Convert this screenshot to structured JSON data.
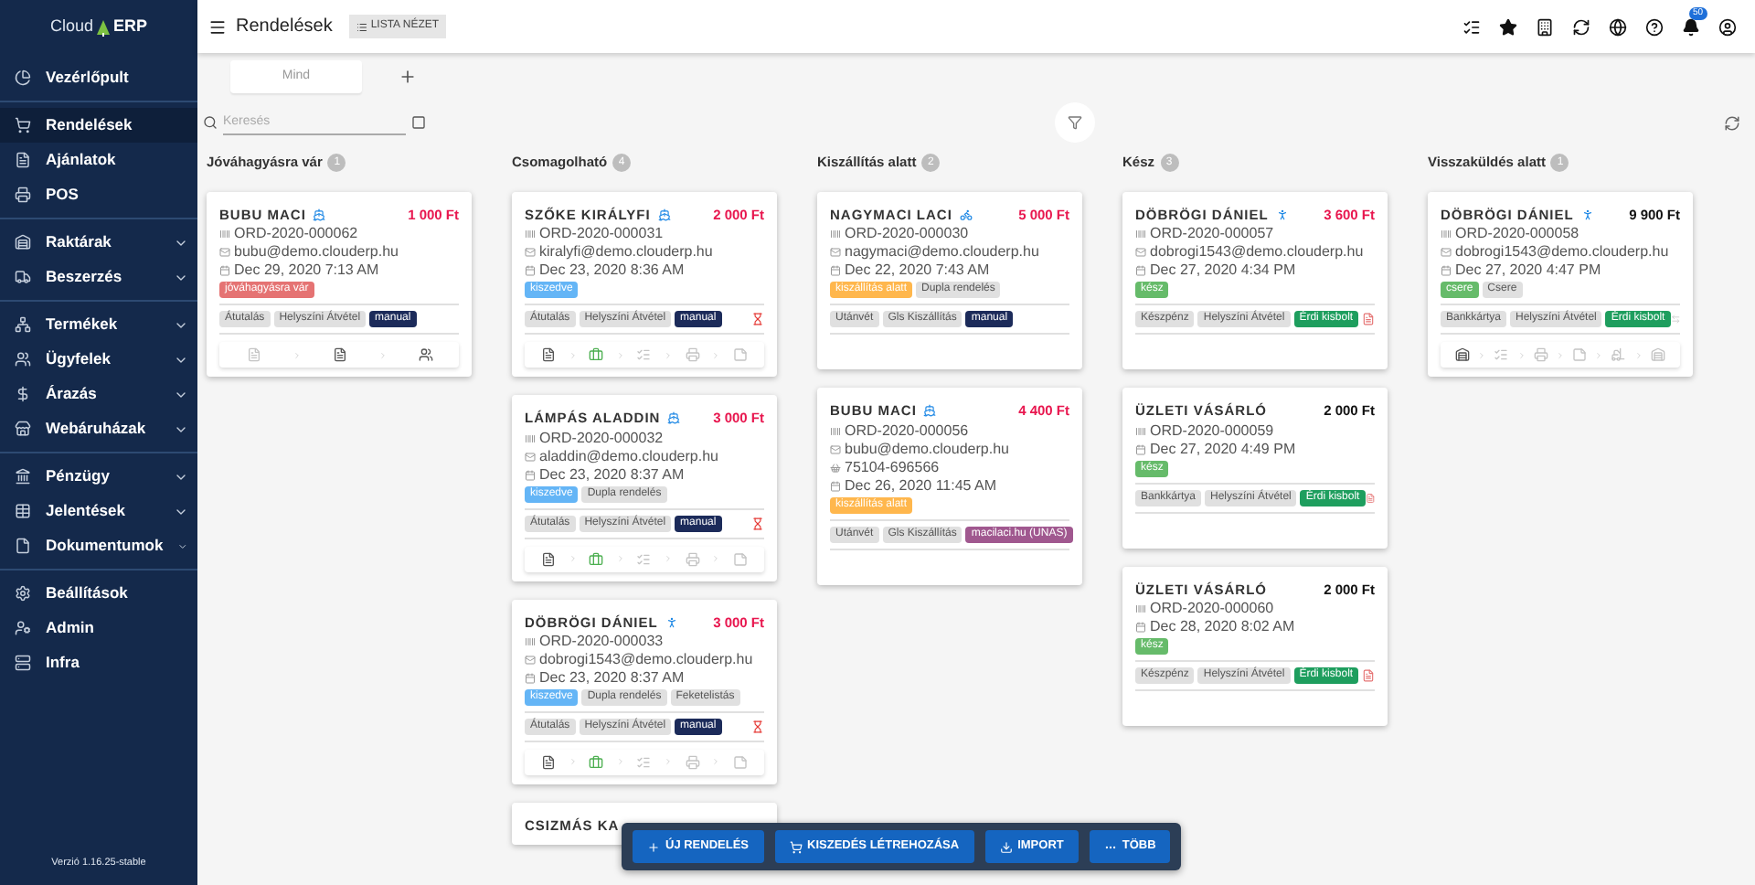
{
  "sidebar": {
    "logo": {
      "left": "Cloud",
      "right": "ERP"
    },
    "groups": [
      [
        {
          "label": "Vezérlőpult",
          "kind": "dashboard",
          "expandable": false,
          "selected": false
        }
      ],
      [
        {
          "label": "Rendelések",
          "kind": "cart",
          "expandable": false,
          "selected": true
        },
        {
          "label": "Ajánlatok",
          "kind": "offer",
          "expandable": false,
          "selected": false
        },
        {
          "label": "POS",
          "kind": "pos",
          "expandable": false,
          "selected": false
        }
      ],
      [
        {
          "label": "Raktárak",
          "kind": "warehouse",
          "expandable": true,
          "selected": false
        },
        {
          "label": "Beszerzés",
          "kind": "truck",
          "expandable": true,
          "selected": false
        }
      ],
      [
        {
          "label": "Termékek",
          "kind": "products",
          "expandable": true,
          "selected": false
        },
        {
          "label": "Ügyfelek",
          "kind": "customers",
          "expandable": true,
          "selected": false
        },
        {
          "label": "Árazás",
          "kind": "pricing",
          "expandable": true,
          "selected": false
        },
        {
          "label": "Webáruházak",
          "kind": "store",
          "expandable": true,
          "selected": false
        }
      ],
      [
        {
          "label": "Pénzügy",
          "kind": "finance",
          "expandable": true,
          "selected": false
        },
        {
          "label": "Jelentések",
          "kind": "reports",
          "expandable": true,
          "selected": false
        },
        {
          "label": "Dokumentumok",
          "kind": "documents",
          "expandable": true,
          "selected": false
        }
      ],
      [
        {
          "label": "Beállítások",
          "kind": "settings",
          "expandable": false,
          "selected": false
        },
        {
          "label": "Admin",
          "kind": "admin",
          "expandable": false,
          "selected": false
        },
        {
          "label": "Infra",
          "kind": "infra",
          "expandable": false,
          "selected": false
        }
      ]
    ],
    "version": "Verzió 1.16.25-stable"
  },
  "topbar": {
    "title": "Rendelések",
    "view_button": "LISTA NÉZET",
    "notification_count": "50"
  },
  "tabs": [
    {
      "label": "Mind",
      "selected": true
    }
  ],
  "search": {
    "placeholder": "Keresés"
  },
  "columns": [
    {
      "title": "Jóváhagyásra vár",
      "count": "1",
      "cards": [
        {
          "name": "BUBU MACI",
          "customer_icon": {
            "kind": "ship"
          },
          "amount": "1 000 Ft",
          "amount_highlight": true,
          "order": "ORD-2020-000062",
          "email": "bubu@demo.clouderp.hu",
          "date": "Dec 29, 2020 7:13 AM",
          "status_tags": [
            {
              "label": "jóváhagyásra vár",
              "color": "#e57373"
            }
          ],
          "info_tags": [
            {
              "label": "Átutalás",
              "color": "#e0e0e0"
            },
            {
              "label": "Helyszíni Átvétel",
              "color": "#e0e0e0"
            },
            {
              "label": "manual",
              "color": "#1c2b5a"
            }
          ],
          "steps": [
            {
              "kind": "document",
              "done": false,
              "active": false
            },
            {
              "kind": "document",
              "done": true,
              "active": false
            },
            {
              "kind": "people",
              "done": true,
              "active": false
            }
          ]
        }
      ]
    },
    {
      "title": "Csomagolható",
      "count": "4",
      "cards": [
        {
          "name": "SZŐKE KIRÁLYFI",
          "customer_icon": {
            "kind": "ship"
          },
          "amount": "2 000 Ft",
          "amount_highlight": true,
          "order": "ORD-2020-000031",
          "email": "kiralyfi@demo.clouderp.hu",
          "date": "Dec 23, 2020 8:36 AM",
          "status_tags": [
            {
              "label": "kiszedve",
              "color": "#64b5f6"
            }
          ],
          "info_tags": [
            {
              "label": "Átutalás",
              "color": "#e0e0e0"
            },
            {
              "label": "Helyszíni Átvétel",
              "color": "#e0e0e0"
            },
            {
              "label": "manual",
              "color": "#1c2b5a"
            }
          ],
          "flag": {
            "kind": "hourglass"
          },
          "steps": [
            {
              "kind": "document",
              "done": true,
              "active": false
            },
            {
              "kind": "briefcase",
              "done": false,
              "active": true
            },
            {
              "kind": "list",
              "done": false,
              "active": false
            },
            {
              "kind": "printer",
              "done": false,
              "active": false
            },
            {
              "kind": "note",
              "done": false,
              "active": false
            }
          ]
        },
        {
          "name": "LÁMPÁS ALADDIN",
          "customer_icon": {
            "kind": "ship"
          },
          "amount": "3 000 Ft",
          "amount_highlight": true,
          "order": "ORD-2020-000032",
          "email": "aladdin@demo.clouderp.hu",
          "date": "Dec 23, 2020 8:37 AM",
          "status_tags": [
            {
              "label": "kiszedve",
              "color": "#64b5f6"
            },
            {
              "label": "Dupla rendelés",
              "color": "#e0e0e0"
            }
          ],
          "info_tags": [
            {
              "label": "Átutalás",
              "color": "#e0e0e0"
            },
            {
              "label": "Helyszíni Átvétel",
              "color": "#e0e0e0"
            },
            {
              "label": "manual",
              "color": "#1c2b5a"
            }
          ],
          "flag": {
            "kind": "hourglass"
          },
          "steps": [
            {
              "kind": "document",
              "done": true,
              "active": false
            },
            {
              "kind": "briefcase",
              "done": false,
              "active": true
            },
            {
              "kind": "list",
              "done": false,
              "active": false
            },
            {
              "kind": "printer",
              "done": false,
              "active": false
            },
            {
              "kind": "note",
              "done": false,
              "active": false
            }
          ]
        },
        {
          "name": "DÖBRÖGI DÁNIEL",
          "customer_icon": {
            "kind": "person"
          },
          "amount": "3 000 Ft",
          "amount_highlight": true,
          "order": "ORD-2020-000033",
          "email": "dobrogi1543@demo.clouderp.hu",
          "date": "Dec 23, 2020 8:37 AM",
          "status_tags": [
            {
              "label": "kiszedve",
              "color": "#64b5f6"
            },
            {
              "label": "Dupla rendelés",
              "color": "#e0e0e0"
            },
            {
              "label": "Feketelistás",
              "color": "#e0e0e0"
            }
          ],
          "info_tags": [
            {
              "label": "Átutalás",
              "color": "#e0e0e0"
            },
            {
              "label": "Helyszíni Átvétel",
              "color": "#e0e0e0"
            },
            {
              "label": "manual",
              "color": "#1c2b5a"
            }
          ],
          "flag": {
            "kind": "hourglass"
          },
          "steps": [
            {
              "kind": "document",
              "done": true,
              "active": false
            },
            {
              "kind": "briefcase",
              "done": false,
              "active": true
            },
            {
              "kind": "list",
              "done": false,
              "active": false
            },
            {
              "kind": "printer",
              "done": false,
              "active": false
            },
            {
              "kind": "note",
              "done": false,
              "active": false
            }
          ]
        },
        {
          "name": "CSIZMÁS KA"
        }
      ]
    },
    {
      "title": "Kiszállítás alatt",
      "count": "2",
      "cards": [
        {
          "name": "NAGYMACI LACI",
          "customer_icon": {
            "kind": "bike"
          },
          "amount": "5 000 Ft",
          "amount_highlight": true,
          "order": "ORD-2020-000030",
          "email": "nagymaci@demo.clouderp.hu",
          "date": "Dec 22, 2020 7:43 AM",
          "status_tags": [
            {
              "label": "kiszállítás alatt",
              "color": "#ffb74d"
            },
            {
              "label": "Dupla rendelés",
              "color": "#e0e0e0"
            }
          ],
          "info_tags": [
            {
              "label": "Utánvét",
              "color": "#e0e0e0"
            },
            {
              "label": "Gls Kiszállítás",
              "color": "#e0e0e0"
            },
            {
              "label": "manual",
              "color": "#1c2b5a"
            }
          ]
        },
        {
          "name": "BUBU MACI",
          "customer_icon": {
            "kind": "ship"
          },
          "amount": "4 400 Ft",
          "amount_highlight": true,
          "order": "ORD-2020-000056",
          "email": "bubu@demo.clouderp.hu",
          "phone": "75104-696566",
          "date": "Dec 26, 2020 11:45 AM",
          "status_tags": [
            {
              "label": "kiszállítás alatt",
              "color": "#ffb74d"
            }
          ],
          "info_tags": [
            {
              "label": "Utánvét",
              "color": "#e0e0e0"
            },
            {
              "label": "Gls Kiszállítás",
              "color": "#e0e0e0"
            },
            {
              "label": "macilaci.hu (UNAS)",
              "color": "#a0588f"
            }
          ]
        }
      ]
    },
    {
      "title": "Kész",
      "count": "3",
      "cards": [
        {
          "name": "DÖBRÖGI DÁNIEL",
          "customer_icon": {
            "kind": "person"
          },
          "amount": "3 600 Ft",
          "amount_highlight": true,
          "order": "ORD-2020-000057",
          "email": "dobrogi1543@demo.clouderp.hu",
          "date": "Dec 27, 2020 4:34 PM",
          "status_tags": [
            {
              "label": "kész",
              "color": "#66bb6a"
            }
          ],
          "info_tags": [
            {
              "label": "Készpénz",
              "color": "#e0e0e0"
            },
            {
              "label": "Helyszíni Átvétel",
              "color": "#e0e0e0"
            },
            {
              "label": "Érdi kisbolt",
              "color": "#1e9e5e"
            }
          ],
          "flag": {
            "kind": "pdf"
          }
        },
        {
          "name": "ÜZLETI VÁSÁRLÓ",
          "amount": "2 000 Ft",
          "amount_highlight": false,
          "order": "ORD-2020-000059",
          "date": "Dec 27, 2020 4:49 PM",
          "status_tags": [
            {
              "label": "kész",
              "color": "#66bb6a"
            }
          ],
          "info_tags": [
            {
              "label": "Bankkártya",
              "color": "#e0e0e0"
            },
            {
              "label": "Helyszíni Átvétel",
              "color": "#e0e0e0"
            },
            {
              "label": "Érdi kisbolt",
              "color": "#1e9e5e"
            }
          ],
          "flag": {
            "kind": "pdf"
          }
        },
        {
          "name": "ÜZLETI VÁSÁRLÓ",
          "amount": "2 000 Ft",
          "amount_highlight": false,
          "order": "ORD-2020-000060",
          "date": "Dec 28, 2020 8:02 AM",
          "status_tags": [
            {
              "label": "kész",
              "color": "#66bb6a"
            }
          ],
          "info_tags": [
            {
              "label": "Készpénz",
              "color": "#e0e0e0"
            },
            {
              "label": "Helyszíni Átvétel",
              "color": "#e0e0e0"
            },
            {
              "label": "Érdi kisbolt",
              "color": "#1e9e5e"
            }
          ],
          "flag": {
            "kind": "pdf"
          }
        }
      ]
    },
    {
      "title": "Visszaküldés alatt",
      "count": "1",
      "cards": [
        {
          "name": "DÖBRÖGI DÁNIEL",
          "customer_icon": {
            "kind": "person"
          },
          "amount": "9 900 Ft",
          "amount_highlight": false,
          "order": "ORD-2020-000058",
          "email": "dobrogi1543@demo.clouderp.hu",
          "date": "Dec 27, 2020 4:47 PM",
          "status_tags": [
            {
              "label": "csere",
              "color": "#66bb6a"
            },
            {
              "label": "Csere",
              "color": "#e0e0e0"
            }
          ],
          "info_tags": [
            {
              "label": "Bankkártya",
              "color": "#e0e0e0"
            },
            {
              "label": "Helyszíni Átvétel",
              "color": "#e0e0e0"
            },
            {
              "label": "Érdi kisbolt",
              "color": "#1e9e5e"
            }
          ],
          "flag": {
            "kind": "swap"
          },
          "steps": [
            {
              "kind": "warehouse",
              "done": true,
              "active": false
            },
            {
              "kind": "list",
              "done": false,
              "active": false
            },
            {
              "kind": "printer",
              "done": false,
              "active": false
            },
            {
              "kind": "note",
              "done": false,
              "active": false
            },
            {
              "kind": "forklift",
              "done": false,
              "active": false
            },
            {
              "kind": "warehouse",
              "done": false,
              "active": false
            }
          ]
        }
      ]
    }
  ],
  "actions": [
    {
      "label": "ÚJ RENDELÉS",
      "kind": "add"
    },
    {
      "label": "KISZEDÉS LÉTREHOZÁSA",
      "kind": "pick"
    },
    {
      "label": "IMPORT",
      "kind": "import"
    },
    {
      "label": "TÖBB",
      "kind": "more"
    }
  ]
}
